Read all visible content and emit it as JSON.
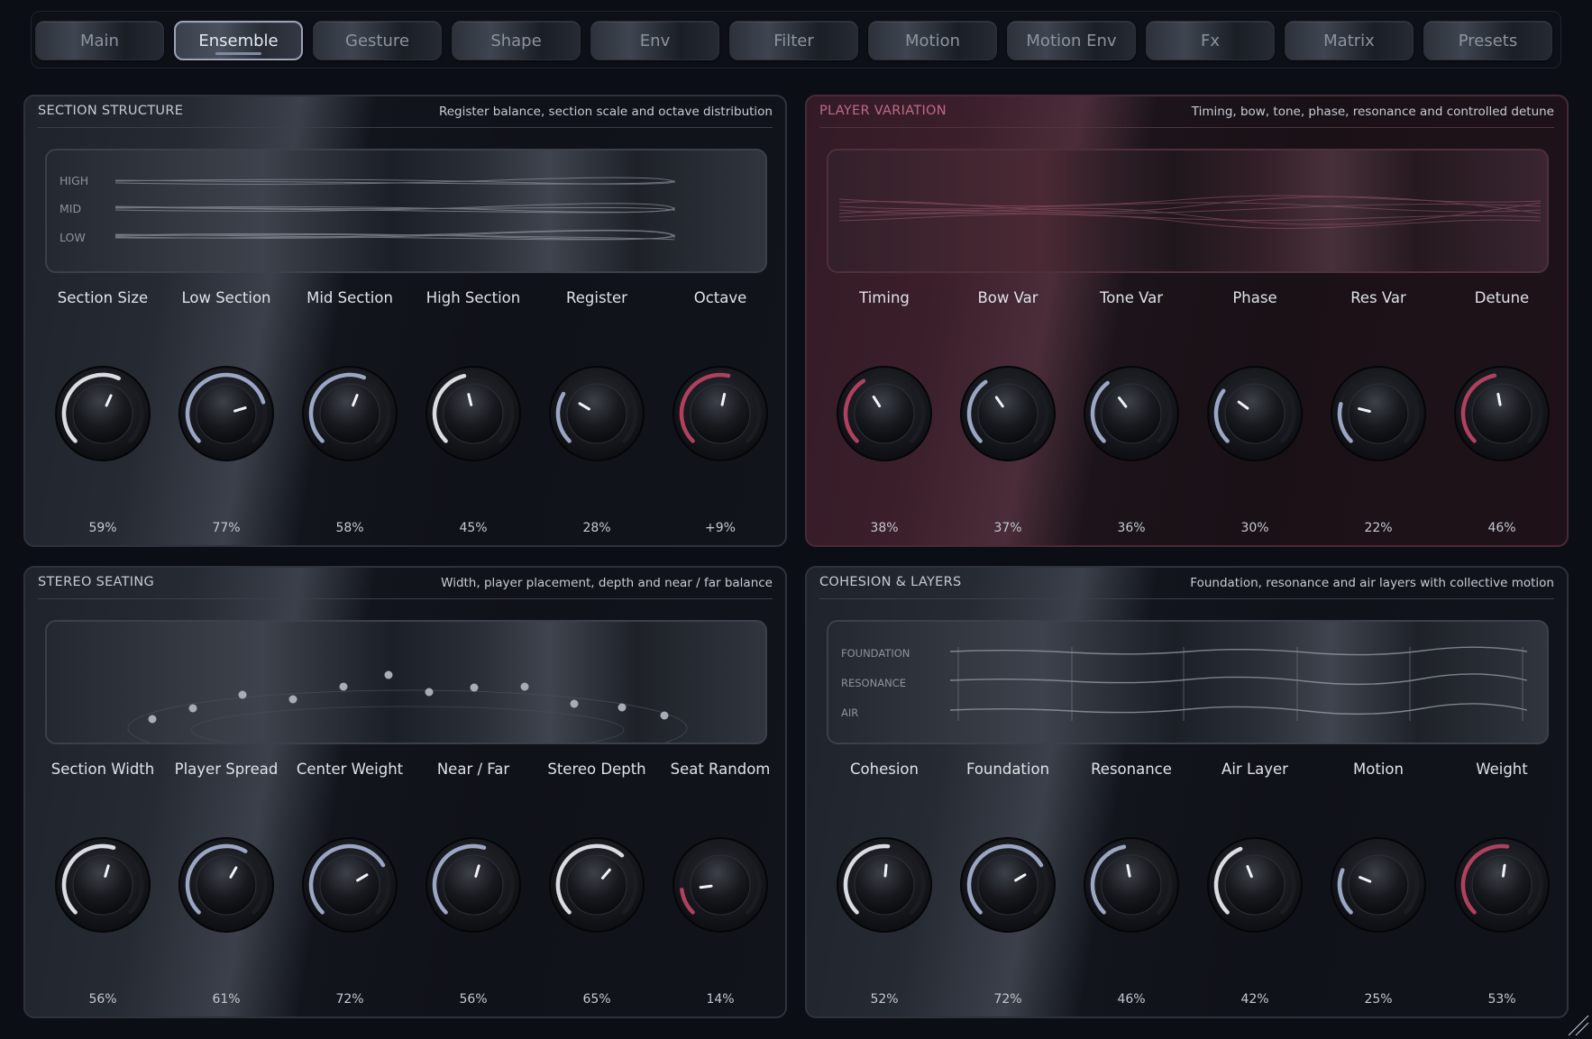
{
  "tabs": [
    {
      "label": "Main",
      "active": false
    },
    {
      "label": "Ensemble",
      "active": true
    },
    {
      "label": "Gesture",
      "active": false
    },
    {
      "label": "Shape",
      "active": false
    },
    {
      "label": "Env",
      "active": false
    },
    {
      "label": "Filter",
      "active": false
    },
    {
      "label": "Motion",
      "active": false
    },
    {
      "label": "Motion Env",
      "active": false
    },
    {
      "label": "Fx",
      "active": false
    },
    {
      "label": "Matrix",
      "active": false
    },
    {
      "label": "Presets",
      "active": false
    }
  ],
  "colors": {
    "accent_blue": "#9aa6c4",
    "accent_white": "#d9dce3",
    "accent_red": "#b0405e",
    "panel_pink_title": "#c06a83"
  },
  "panels": {
    "section_structure": {
      "title": "SECTION STRUCTURE",
      "subtitle": "Register balance, section scale and octave distribution",
      "viz_labels": [
        "HIGH",
        "MID",
        "LOW"
      ],
      "knobs": [
        {
          "label": "Section Size",
          "value": "59%",
          "level": 0.59,
          "color": "white"
        },
        {
          "label": "Low Section",
          "value": "77%",
          "level": 0.77,
          "color": "blue"
        },
        {
          "label": "Mid Section",
          "value": "58%",
          "level": 0.58,
          "color": "blue"
        },
        {
          "label": "High Section",
          "value": "45%",
          "level": 0.45,
          "color": "white"
        },
        {
          "label": "Register",
          "value": "28%",
          "level": 0.28,
          "color": "blue"
        },
        {
          "label": "Octave",
          "value": "+9%",
          "level": 0.545,
          "color": "red"
        }
      ]
    },
    "player_variation": {
      "title": "PLAYER VARIATION",
      "subtitle": "Timing, bow, tone, phase, resonance and controlled detune",
      "knobs": [
        {
          "label": "Timing",
          "value": "38%",
          "level": 0.38,
          "color": "red"
        },
        {
          "label": "Bow Var",
          "value": "37%",
          "level": 0.37,
          "color": "blue"
        },
        {
          "label": "Tone Var",
          "value": "36%",
          "level": 0.36,
          "color": "blue"
        },
        {
          "label": "Phase",
          "value": "30%",
          "level": 0.3,
          "color": "blue"
        },
        {
          "label": "Res Var",
          "value": "22%",
          "level": 0.22,
          "color": "blue"
        },
        {
          "label": "Detune",
          "value": "46%",
          "level": 0.46,
          "color": "red"
        }
      ]
    },
    "stereo_seating": {
      "title": "STEREO SEATING",
      "subtitle": "Width, player placement, depth and near / far balance",
      "knobs": [
        {
          "label": "Section Width",
          "value": "56%",
          "level": 0.56,
          "color": "white"
        },
        {
          "label": "Player Spread",
          "value": "61%",
          "level": 0.61,
          "color": "blue"
        },
        {
          "label": "Center Weight",
          "value": "72%",
          "level": 0.72,
          "color": "blue"
        },
        {
          "label": "Near / Far",
          "value": "56%",
          "level": 0.56,
          "color": "blue"
        },
        {
          "label": "Stereo Depth",
          "value": "65%",
          "level": 0.65,
          "color": "white"
        },
        {
          "label": "Seat Random",
          "value": "14%",
          "level": 0.14,
          "color": "red"
        }
      ]
    },
    "cohesion_layers": {
      "title": "COHESION & LAYERS",
      "subtitle": "Foundation, resonance and air layers with collective motion",
      "viz_labels": [
        "FOUNDATION",
        "RESONANCE",
        "AIR"
      ],
      "knobs": [
        {
          "label": "Cohesion",
          "value": "52%",
          "level": 0.52,
          "color": "white"
        },
        {
          "label": "Foundation",
          "value": "72%",
          "level": 0.72,
          "color": "blue"
        },
        {
          "label": "Resonance",
          "value": "46%",
          "level": 0.46,
          "color": "blue"
        },
        {
          "label": "Air Layer",
          "value": "42%",
          "level": 0.42,
          "color": "white"
        },
        {
          "label": "Motion",
          "value": "25%",
          "level": 0.25,
          "color": "blue"
        },
        {
          "label": "Weight",
          "value": "53%",
          "level": 0.53,
          "color": "red"
        }
      ]
    }
  }
}
